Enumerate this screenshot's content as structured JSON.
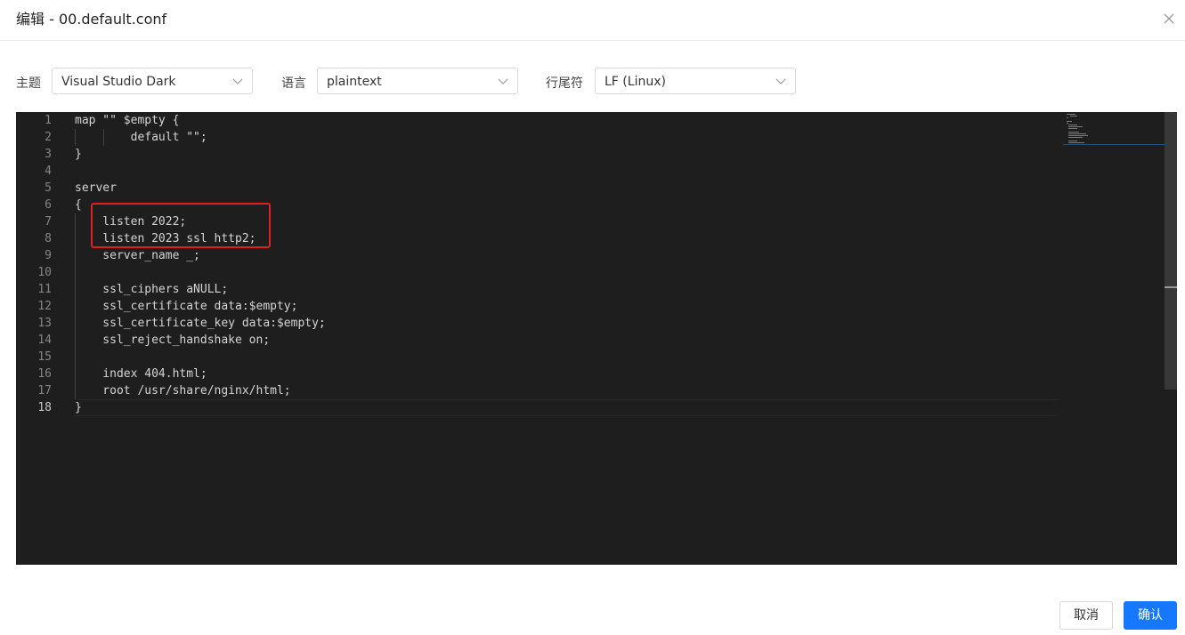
{
  "dialog": {
    "title": "编辑 - 00.default.conf"
  },
  "settings": {
    "theme_label": "主题",
    "theme_value": "Visual Studio Dark",
    "language_label": "语言",
    "language_value": "plaintext",
    "eol_label": "行尾符",
    "eol_value": "LF (Linux)"
  },
  "editor": {
    "lines": [
      "map \"\" $empty {",
      "        default \"\";",
      "}",
      "",
      "server",
      "{",
      "    listen 2022;",
      "    listen 2023 ssl http2;",
      "    server_name _;",
      "",
      "    ssl_ciphers aNULL;",
      "    ssl_certificate data:$empty;",
      "    ssl_certificate_key data:$empty;",
      "    ssl_reject_handshake on;",
      "",
      "    index 404.html;",
      "    root /usr/share/nginx/html;",
      "}"
    ],
    "line_numbers": [
      "1",
      "2",
      "3",
      "4",
      "5",
      "6",
      "7",
      "8",
      "9",
      "10",
      "11",
      "12",
      "13",
      "14",
      "15",
      "16",
      "17",
      "18"
    ],
    "active_line": 18
  },
  "footer": {
    "cancel_label": "取消",
    "ok_label": "确认"
  },
  "colors": {
    "primary": "#1677ff",
    "editor_bg": "#1e1e1e",
    "annotation": "#e02020"
  }
}
